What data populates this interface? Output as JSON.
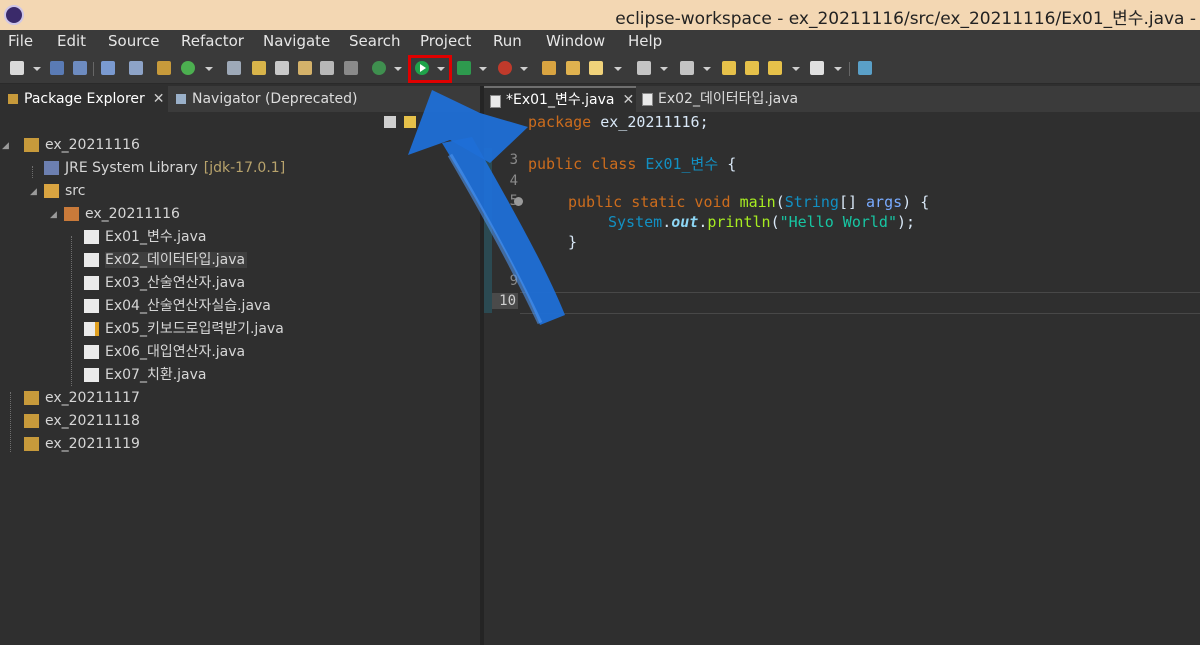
{
  "window": {
    "title": "eclipse-workspace - ex_20211116/src/ex_20211116/Ex01_변수.java -"
  },
  "menu": [
    "File",
    "Edit",
    "Source",
    "Refactor",
    "Navigate",
    "Search",
    "Project",
    "Run",
    "Window",
    "Help"
  ],
  "left_panel": {
    "tabs": [
      {
        "label": "Package Explorer",
        "close": "✕"
      },
      {
        "label": "Navigator (Deprecated)"
      }
    ],
    "tree": {
      "project": "ex_20211116",
      "jre_label": "JRE System Library",
      "jre_version": "[jdk-17.0.1]",
      "src": "src",
      "package": "ex_20211116",
      "files": [
        "Ex01_변수.java",
        "Ex02_데이터타입.java",
        "Ex03_산술연산자.java",
        "Ex04_산술연산자실습.java",
        "Ex05_키보드로입력받기.java",
        "Ex06_대입연산자.java",
        "Ex07_치환.java"
      ],
      "other_projects": [
        "ex_20211117",
        "ex_20211118",
        "ex_20211119"
      ]
    }
  },
  "editor": {
    "tabs": [
      {
        "label": "*Ex01_변수.java",
        "close": "✕"
      },
      {
        "label": "Ex02_데이터타입.java"
      }
    ],
    "line_numbers": {
      "l3": "3",
      "l4": "4",
      "l5": "5",
      "l9": "9",
      "l10": "10"
    },
    "code": {
      "pkg_kw": "package",
      "pkg_name": " ex_20211116;",
      "pub": "public",
      "class_kw": " class ",
      "class_name": "Ex01_변수",
      "brace_open": " {",
      "m_pub": "public",
      "m_static": " static",
      "m_void": " void",
      "m_name": " main",
      "m_paren": "(",
      "m_type": "String",
      "m_arr": "[] ",
      "m_arg": "args",
      "m_close": ") {",
      "sys": "System",
      "dot1": ".",
      "out": "out",
      "dot2": ".",
      "println": "println",
      "paren": "(",
      "str": "\"Hello World\"",
      "end": ");",
      "m_brace_close": "}"
    }
  },
  "colors": {
    "titlebar": "#f3d7b3",
    "highlight": "#e00000",
    "arrow": "#1f6fd6"
  },
  "icons": {
    "run": "run-icon",
    "annotation": "hand-drawn-blue-arrow"
  }
}
